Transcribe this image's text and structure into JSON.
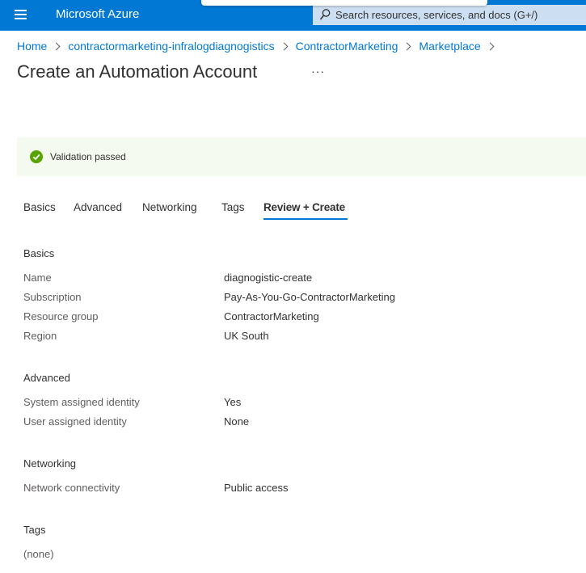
{
  "topbar": {
    "brand": "Microsoft Azure",
    "search_placeholder": "Search resources, services, and docs (G+/)",
    "color": "#0078d4"
  },
  "breadcrumb": [
    "Home",
    "contractormarketing-infralogdiagnogistics",
    "ContractorMarketing",
    "Marketplace"
  ],
  "page_title": "Create an Automation Account",
  "more_label": "···",
  "validation": {
    "message": "Validation passed",
    "status_color": "#57a300"
  },
  "tabs": [
    "Basics",
    "Advanced",
    "Networking",
    "Tags",
    "Review + Create"
  ],
  "active_tab": "Review + Create",
  "review": {
    "basics": {
      "heading": "Basics",
      "rows": [
        {
          "label": "Name",
          "value": "diagnogistic-create"
        },
        {
          "label": "Subscription",
          "value": "Pay-As-You-Go-ContractorMarketing"
        },
        {
          "label": "Resource group",
          "value": "ContractorMarketing"
        },
        {
          "label": "Region",
          "value": "UK South"
        }
      ]
    },
    "advanced": {
      "heading": "Advanced",
      "rows": [
        {
          "label": "System assigned identity",
          "value": "Yes"
        },
        {
          "label": "User assigned identity",
          "value": "None"
        }
      ]
    },
    "networking": {
      "heading": "Networking",
      "rows": [
        {
          "label": "Network connectivity",
          "value": "Public access"
        }
      ]
    },
    "tags": {
      "heading": "Tags",
      "empty_text": "(none)"
    }
  }
}
